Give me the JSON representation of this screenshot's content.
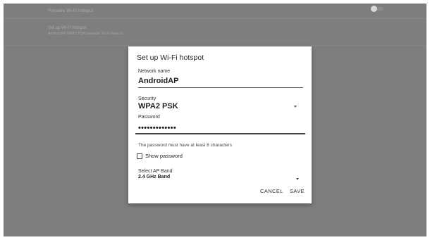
{
  "background": {
    "portable_hotspot_label": "Portable Wi-Fi hotspot",
    "setup_title": "Set up Wi-Fi hotspot",
    "setup_subtitle": "AndroidAP WPA2 PSK portable Wi-Fi hotspot"
  },
  "dialog": {
    "title": "Set up Wi-Fi hotspot",
    "network_name_label": "Network name",
    "network_name_value": "AndroidAP",
    "security_label": "Security",
    "security_value": "WPA2 PSK",
    "password_label": "Password",
    "password_value": "•••••••••••••",
    "password_hint": "The password must have at least 8 characters",
    "show_password_label": "Show password",
    "ap_band_label": "Select AP Band",
    "ap_band_value": "2.4 GHz Band",
    "cancel_label": "CANCEL",
    "save_label": "SAVE"
  },
  "colors": {
    "scrim": "#7e7e7e",
    "dialog_bg": "#ffffff",
    "text_primary": "#1f1f1f"
  }
}
